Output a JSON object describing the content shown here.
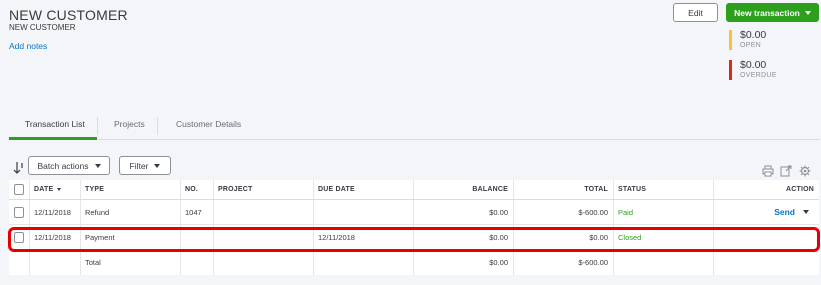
{
  "customer": {
    "title": "NEW CUSTOMER",
    "subtitle": "NEW CUSTOMER",
    "add_notes": "Add notes"
  },
  "actions": {
    "edit": "Edit",
    "new_transaction": "New transaction"
  },
  "summary": {
    "open": {
      "amount": "$0.00",
      "label": "OPEN",
      "color": "#f7c32e"
    },
    "overdue": {
      "amount": "$0.00",
      "label": "OVERDUE",
      "color": "#d52b1e"
    }
  },
  "tabs": [
    {
      "label": "Transaction List",
      "active": true
    },
    {
      "label": "Projects",
      "active": false
    },
    {
      "label": "Customer Details",
      "active": false
    }
  ],
  "toolbar": {
    "batch_actions": "Batch actions",
    "filter": "Filter",
    "icons": [
      "sort-icon",
      "print-icon",
      "export-icon",
      "settings-icon"
    ]
  },
  "table": {
    "columns": [
      "DATE",
      "TYPE",
      "NO.",
      "PROJECT",
      "DUE DATE",
      "BALANCE",
      "TOTAL",
      "STATUS",
      "ACTION"
    ],
    "rows": [
      {
        "date": "12/11/2018",
        "type": "Refund",
        "no": "1047",
        "project": "",
        "due_date": "",
        "balance": "$0.00",
        "total": "$-600.00",
        "status": "Paid",
        "action": "Send"
      },
      {
        "date": "12/11/2018",
        "type": "Payment",
        "no": "",
        "project": "",
        "due_date": "12/11/2018",
        "balance": "$0.00",
        "total": "$0.00",
        "status": "Closed",
        "action": ""
      }
    ],
    "footer": {
      "label": "Total",
      "balance": "$0.00",
      "total": "$-600.00"
    }
  },
  "colors": {
    "accent_green": "#2ca01c",
    "link_blue": "#0077c5",
    "highlight_red": "#e60000"
  }
}
